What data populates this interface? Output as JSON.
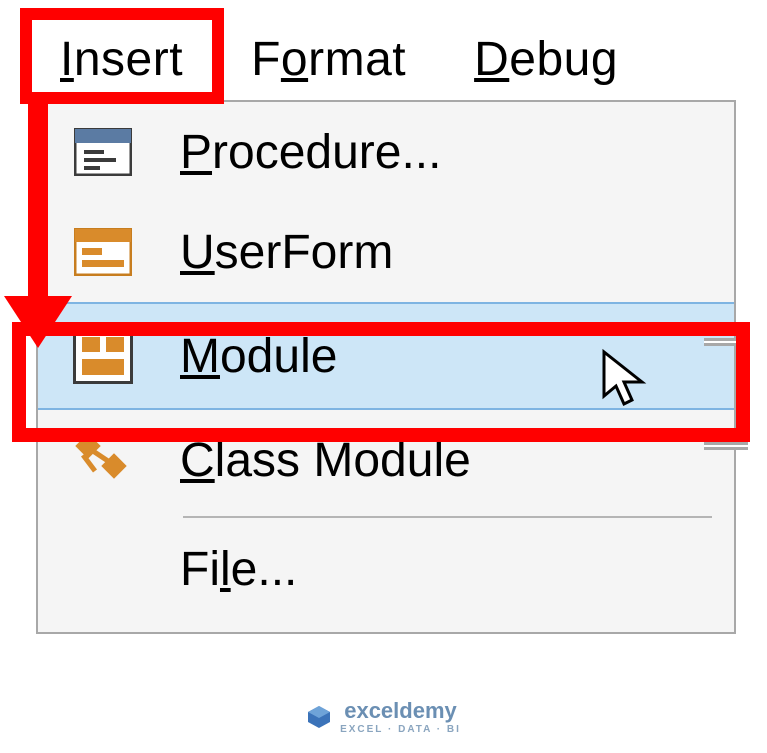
{
  "menubar": {
    "insert": "Insert",
    "format": "Format",
    "debug": "Debug"
  },
  "menu": {
    "procedure": "Procedure...",
    "userform": "UserForm",
    "module": "Module",
    "classmodule": "Class Module",
    "file": "File..."
  },
  "watermark": {
    "brand": "exceldemy",
    "tagline": "EXCEL · DATA · BI"
  }
}
